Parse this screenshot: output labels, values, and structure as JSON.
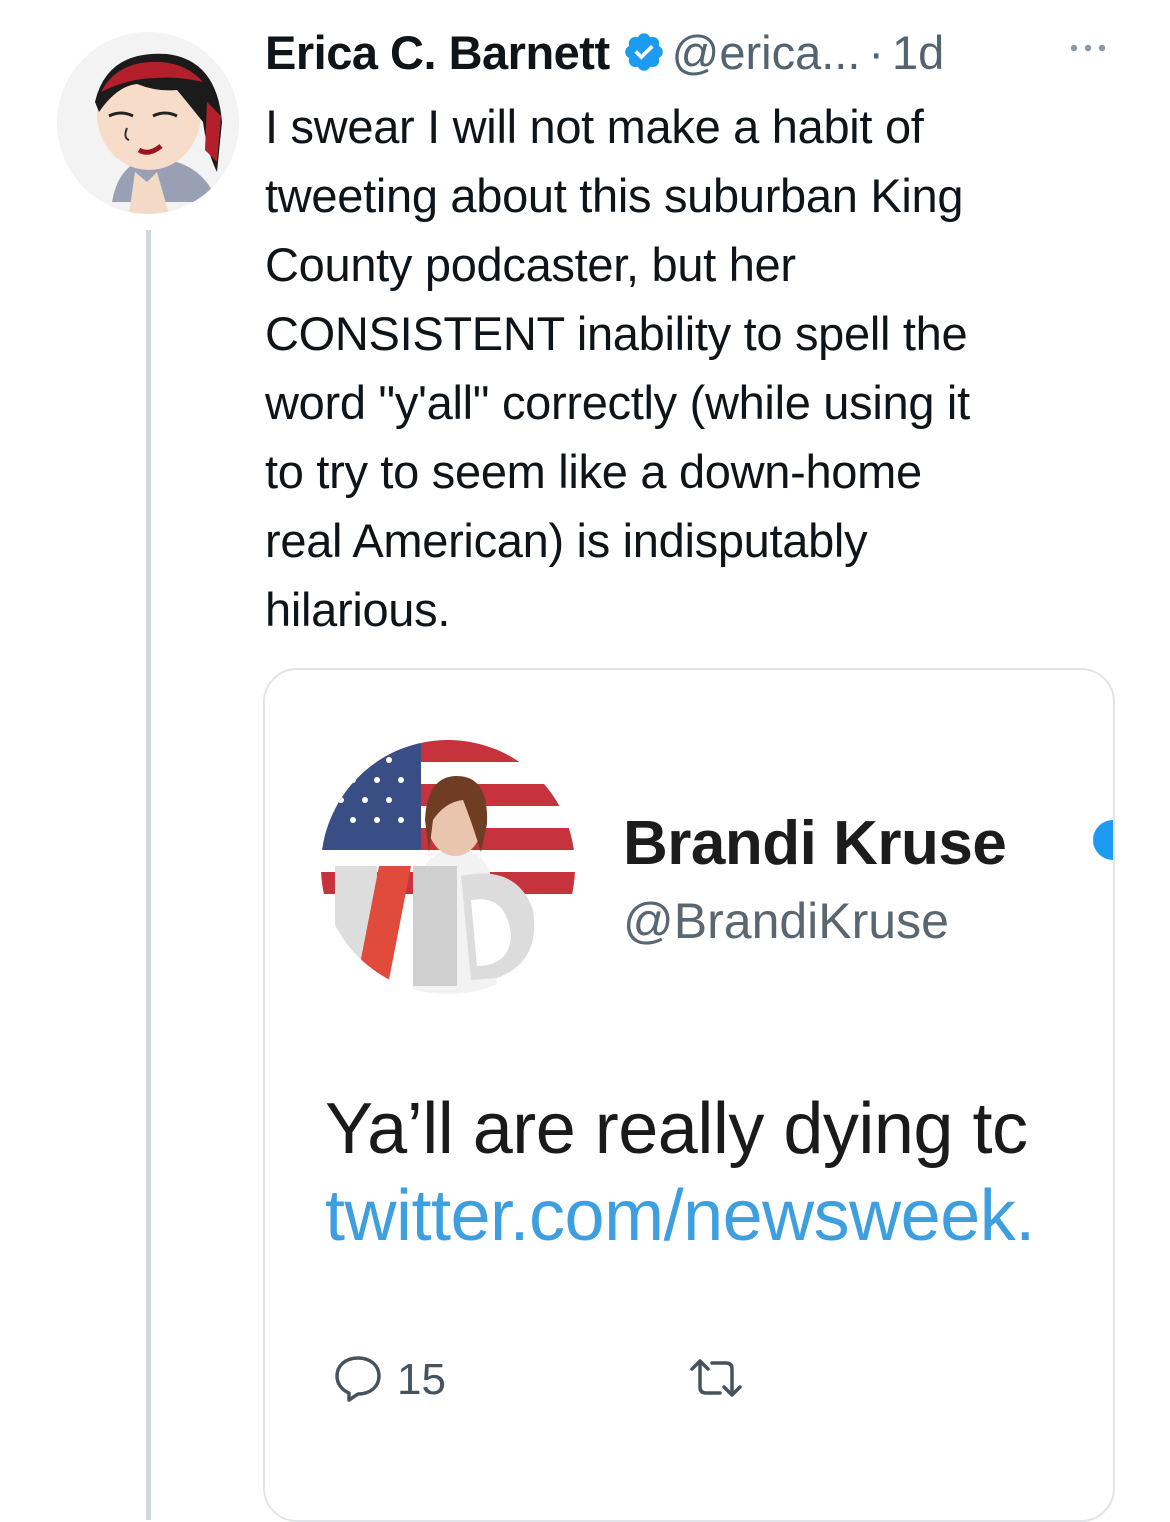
{
  "author": {
    "name": "Erica C. Barnett",
    "handle": "@erica...",
    "separator": "·",
    "time": "1d",
    "more_icon": "more-horizontal-icon",
    "avatar": "cartoon-portrait-avatar"
  },
  "tweet": {
    "lines": [
      "I swear I will not make a habit of",
      "tweeting about this suburban King",
      "County podcaster, but her",
      "CONSISTENT inability to spell the",
      "word \"y'all\" correctly (while using it",
      "to try to seem like a down-home",
      "real American) is indisputably",
      "hilarious."
    ]
  },
  "quoted": {
    "name": "Brandi Kruse",
    "handle": "@BrandiKruse",
    "text": "Ya’ll are really dying tc",
    "link": "twitter.com/newsweek.",
    "reply_count": "15",
    "avatar": "photo-avatar-american-flag"
  },
  "colors": {
    "verified": "#1d9bf0",
    "link": "#3d9fe0",
    "secondary_text": "#536471",
    "border": "#e1e5e9"
  }
}
